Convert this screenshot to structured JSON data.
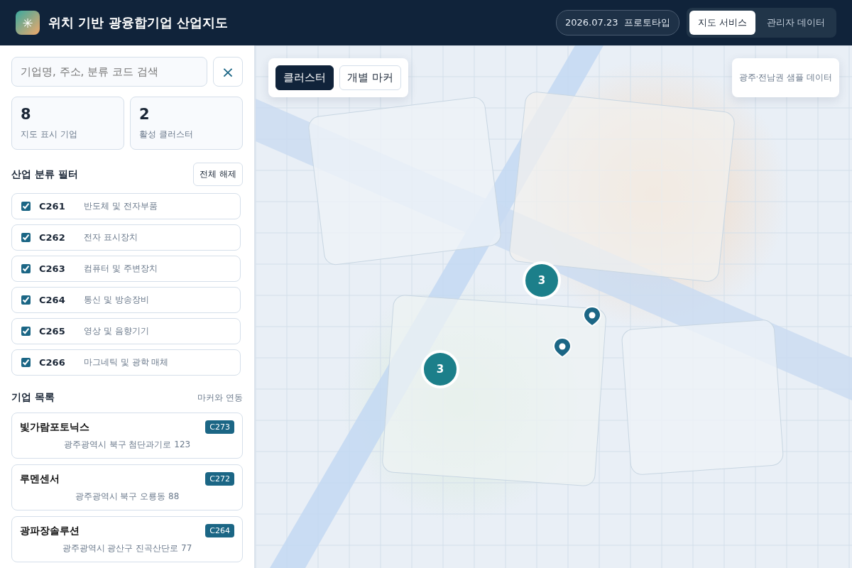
{
  "header": {
    "logo": "✳",
    "title": "위치 기반 광융합기업 산업지도",
    "date": "2026.07.23",
    "badge": "프로토타입",
    "tabs": [
      {
        "label": "지도 서비스",
        "selected": true
      },
      {
        "label": "관리자 데이터",
        "selected": false
      }
    ]
  },
  "search": {
    "placeholder": "기업명, 주소, 분류 코드 검색",
    "clear": "×"
  },
  "stats": [
    {
      "value": "8",
      "label": "지도 표시 기업"
    },
    {
      "value": "2",
      "label": "활성 클러스터"
    }
  ],
  "filter": {
    "title": "산업 분류 필터",
    "action": "전체 해제",
    "items": [
      {
        "code": "C261",
        "name": "반도체 및 전자부품",
        "checked": true
      },
      {
        "code": "C262",
        "name": "전자 표시장치",
        "checked": true
      },
      {
        "code": "C263",
        "name": "컴퓨터 및 주변장치",
        "checked": true
      },
      {
        "code": "C264",
        "name": "통신 및 방송장비",
        "checked": true
      },
      {
        "code": "C265",
        "name": "영상 및 음향기기",
        "checked": true
      },
      {
        "code": "C266",
        "name": "마그네틱 및 광학 매체",
        "checked": true
      }
    ]
  },
  "companies": {
    "title": "기업 목록",
    "note": "마커와 연동",
    "items": [
      {
        "name": "빛가람포토닉스",
        "code": "C273",
        "address": "광주광역시 북구 첨단과기로 123"
      },
      {
        "name": "루멘센서",
        "code": "C272",
        "address": "광주광역시 북구 오룡동 88"
      },
      {
        "name": "광파장솔루션",
        "code": "C264",
        "address": "광주광역시 광산구 진곡산단로 77"
      }
    ]
  },
  "map": {
    "modes": [
      {
        "label": "클러스터",
        "selected": true
      },
      {
        "label": "개별 마커",
        "selected": false
      }
    ],
    "source": "광주·전남권 샘플 데이터",
    "clusters": [
      {
        "count": "3"
      },
      {
        "count": "3"
      }
    ],
    "markers": [
      {
        "kind": "pin"
      },
      {
        "kind": "pin"
      }
    ]
  }
}
